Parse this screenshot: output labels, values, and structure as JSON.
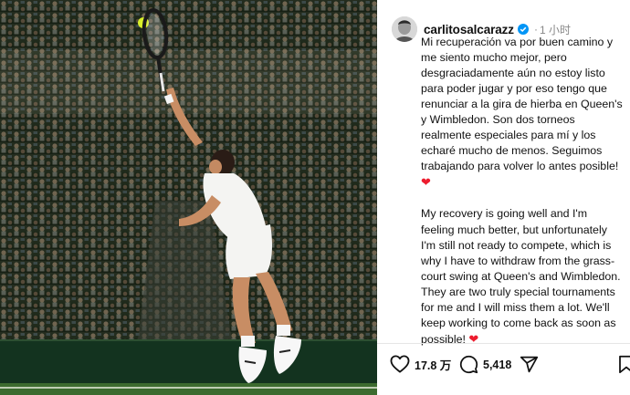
{
  "post": {
    "username": "carlitosalcarazz",
    "verified": true,
    "separator": "·",
    "timestamp": "1 小时",
    "caption_es": "Mi recuperación va por buen camino y me siento mucho mejor, pero desgraciadamente aún no estoy listo para poder jugar y por eso tengo que renunciar a la gira de hierba en Queen's y Wimbledon. Son dos torneos realmente especiales para mí y los echaré mucho de menos. Seguimos trabajando para volver lo antes posible!",
    "caption_en": "My recovery is going well and I'm feeling much better, but unfortunately I'm still not ready to compete, which is why I have to withdraw from the grass-court swing at Queen's and Wimbledon. They are two truly special tournaments for me and I will miss them a lot. We'll keep working to come back as soon as possible!",
    "heart_emoji": "❤"
  },
  "actions": {
    "likes": "17.8 万",
    "comments": "5,418",
    "icons": [
      "heart-outline-icon",
      "comment-bubble-icon",
      "share-paper-plane-icon",
      "bookmark-icon"
    ]
  },
  "colors": {
    "verified_blue": "#0095f6",
    "heart_red": "#ed1c2e",
    "photo_wall": "#1c2a1a",
    "grass": "#3c6b2f"
  }
}
